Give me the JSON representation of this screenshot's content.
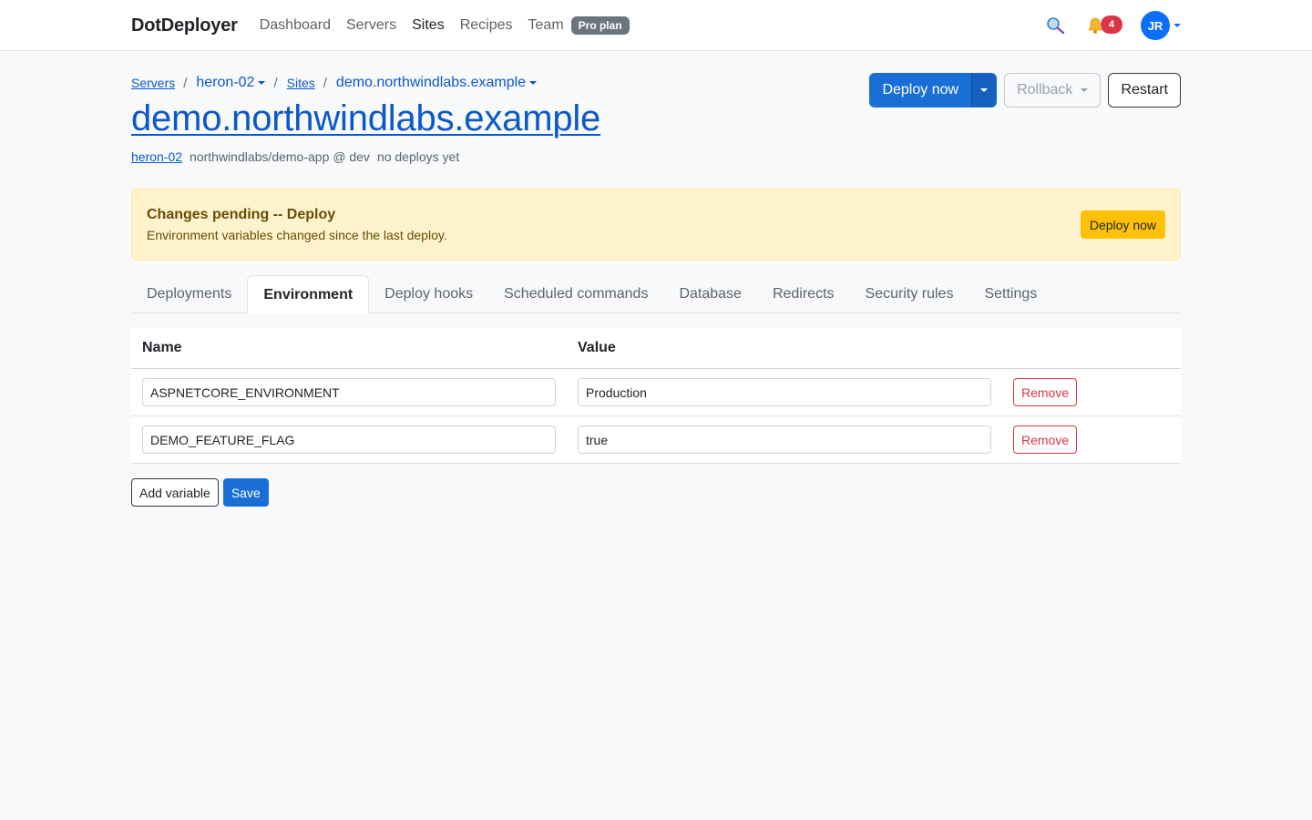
{
  "app": {
    "brand": "DotDeployer",
    "nav": [
      "Dashboard",
      "Servers",
      "Sites",
      "Recipes",
      "Team"
    ],
    "plan_badge": "Pro plan",
    "notification_count": "4",
    "user_initials": "JR",
    "colors": {
      "primary": "#1a6fd6",
      "link": "#0a58ca",
      "warning": "#ffc107",
      "danger": "#dc3545",
      "badge": "#6c757d"
    }
  },
  "breadcrumb": {
    "servers": "Servers",
    "server": "heron-02",
    "sites": "Sites",
    "site": "demo.northwindlabs.example"
  },
  "page": {
    "title": "demo.northwindlabs.example",
    "meta_server": "heron-02",
    "meta_repo": "northwindlabs/demo-app @ dev",
    "meta_status": "no deploys yet"
  },
  "actions": {
    "deploy": "Deploy now",
    "rollback": "Rollback",
    "restart": "Restart"
  },
  "alert": {
    "title": "Changes pending -- Deploy",
    "body": "Environment variables changed since the last deploy.",
    "button": "Deploy now"
  },
  "tabs": [
    "Deployments",
    "Environment",
    "Deploy hooks",
    "Scheduled commands",
    "Database",
    "Redirects",
    "Security rules",
    "Settings"
  ],
  "active_tab": "Environment",
  "env": {
    "headers": {
      "name": "Name",
      "value": "Value"
    },
    "rows": [
      {
        "name": "ASPNETCORE_ENVIRONMENT",
        "value": "Production",
        "remove": "Remove"
      },
      {
        "name": "DEMO_FEATURE_FLAG",
        "value": "true",
        "remove": "Remove"
      }
    ],
    "add_label": "Add variable",
    "save_label": "Save"
  }
}
